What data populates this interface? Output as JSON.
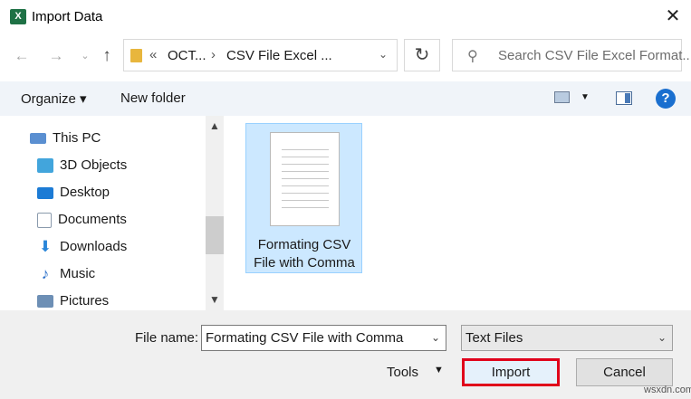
{
  "window": {
    "title": "Import Data",
    "app_icon_glyph": "X",
    "close_glyph": "✕"
  },
  "address": {
    "crumbs": [
      "«",
      "OCT...",
      "›",
      "CSV File Excel ..."
    ],
    "search_placeholder": "Search CSV File Excel Format..."
  },
  "toolbar": {
    "organize_label": "Organize ▾",
    "new_folder_label": "New folder",
    "help_glyph": "?"
  },
  "nav": {
    "items": [
      {
        "label": "This PC",
        "icon": "pc-icon",
        "color": "#5a8fd1"
      },
      {
        "label": "3D Objects",
        "icon": "cube-icon",
        "color": "#42a5dc"
      },
      {
        "label": "Desktop",
        "icon": "desktop-icon",
        "color": "#1c7bd5"
      },
      {
        "label": "Documents",
        "icon": "documents-icon",
        "color": "#8a9aac"
      },
      {
        "label": "Downloads",
        "icon": "download-icon",
        "color": "#2a86d9"
      },
      {
        "label": "Music",
        "icon": "music-icon",
        "color": "#2a6fc9"
      },
      {
        "label": "Pictures",
        "icon": "pictures-icon",
        "color": "#6d8fb5"
      }
    ]
  },
  "content": {
    "file_name_line1": "Formating CSV",
    "file_name_line2": "File with Comma"
  },
  "footer": {
    "file_name_label": "File name:",
    "file_name_value": "Formating CSV File with Comma",
    "file_type_value": "Text Files",
    "tools_label": "Tools",
    "import_label": "Import",
    "cancel_label": "Cancel"
  },
  "watermark": "wsxdn.com",
  "colors": {
    "accent": "#1a6fcf",
    "selection": "#cce8ff",
    "highlight_border": "#e0001b"
  }
}
